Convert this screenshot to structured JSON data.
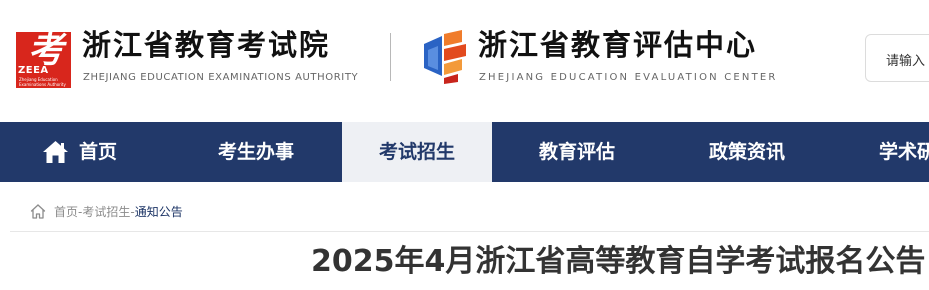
{
  "header": {
    "org1": {
      "logo_char": "考",
      "logo_abbr": "ZEEA",
      "logo_sub_line1": "Zhejiang Education",
      "logo_sub_line2": "Examinations Authority",
      "name": "浙江省教育考试院",
      "name_en": "ZHEJIANG EDUCATION EXAMINATIONS AUTHORITY"
    },
    "org2": {
      "name": "浙江省教育评估中心",
      "name_en": "ZHEJIANG EDUCATION EVALUATION CENTER"
    },
    "search": {
      "placeholder": "请输入"
    }
  },
  "nav": {
    "items": [
      {
        "label": "首页",
        "icon": "home-icon"
      },
      {
        "label": "考生办事"
      },
      {
        "label": "考试招生",
        "active": true
      },
      {
        "label": "教育评估"
      },
      {
        "label": "政策资讯"
      },
      {
        "label": "学术研"
      }
    ]
  },
  "breadcrumb": {
    "icon": "home-outline-icon",
    "items": [
      "首页",
      "考试招生",
      "通知公告"
    ],
    "separator": "-"
  },
  "article": {
    "title": "2025年4月浙江省高等教育自学考试报名公告"
  },
  "colors": {
    "nav_bg": "#22396a",
    "nav_active_bg": "#eef0f4",
    "logo_red": "#d8261c",
    "logo_blue": "#2a63c4",
    "logo_orange": "#f07c2b"
  }
}
